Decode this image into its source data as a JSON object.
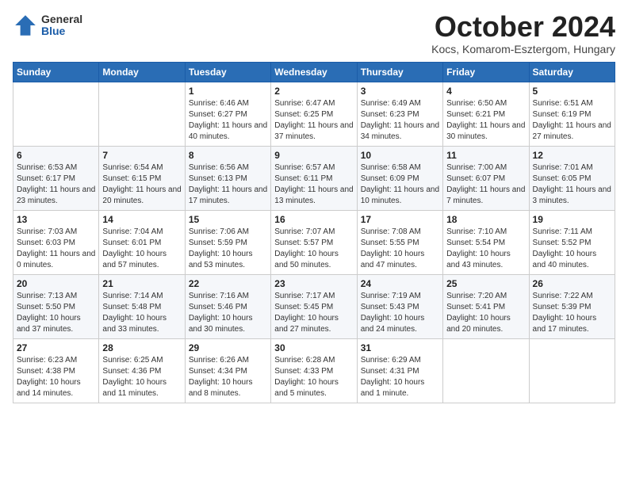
{
  "logo": {
    "general": "General",
    "blue": "Blue"
  },
  "title": "October 2024",
  "subtitle": "Kocs, Komarom-Esztergom, Hungary",
  "headers": [
    "Sunday",
    "Monday",
    "Tuesday",
    "Wednesday",
    "Thursday",
    "Friday",
    "Saturday"
  ],
  "weeks": [
    [
      {
        "day": "",
        "detail": ""
      },
      {
        "day": "",
        "detail": ""
      },
      {
        "day": "1",
        "detail": "Sunrise: 6:46 AM\nSunset: 6:27 PM\nDaylight: 11 hours and 40 minutes."
      },
      {
        "day": "2",
        "detail": "Sunrise: 6:47 AM\nSunset: 6:25 PM\nDaylight: 11 hours and 37 minutes."
      },
      {
        "day": "3",
        "detail": "Sunrise: 6:49 AM\nSunset: 6:23 PM\nDaylight: 11 hours and 34 minutes."
      },
      {
        "day": "4",
        "detail": "Sunrise: 6:50 AM\nSunset: 6:21 PM\nDaylight: 11 hours and 30 minutes."
      },
      {
        "day": "5",
        "detail": "Sunrise: 6:51 AM\nSunset: 6:19 PM\nDaylight: 11 hours and 27 minutes."
      }
    ],
    [
      {
        "day": "6",
        "detail": "Sunrise: 6:53 AM\nSunset: 6:17 PM\nDaylight: 11 hours and 23 minutes."
      },
      {
        "day": "7",
        "detail": "Sunrise: 6:54 AM\nSunset: 6:15 PM\nDaylight: 11 hours and 20 minutes."
      },
      {
        "day": "8",
        "detail": "Sunrise: 6:56 AM\nSunset: 6:13 PM\nDaylight: 11 hours and 17 minutes."
      },
      {
        "day": "9",
        "detail": "Sunrise: 6:57 AM\nSunset: 6:11 PM\nDaylight: 11 hours and 13 minutes."
      },
      {
        "day": "10",
        "detail": "Sunrise: 6:58 AM\nSunset: 6:09 PM\nDaylight: 11 hours and 10 minutes."
      },
      {
        "day": "11",
        "detail": "Sunrise: 7:00 AM\nSunset: 6:07 PM\nDaylight: 11 hours and 7 minutes."
      },
      {
        "day": "12",
        "detail": "Sunrise: 7:01 AM\nSunset: 6:05 PM\nDaylight: 11 hours and 3 minutes."
      }
    ],
    [
      {
        "day": "13",
        "detail": "Sunrise: 7:03 AM\nSunset: 6:03 PM\nDaylight: 11 hours and 0 minutes."
      },
      {
        "day": "14",
        "detail": "Sunrise: 7:04 AM\nSunset: 6:01 PM\nDaylight: 10 hours and 57 minutes."
      },
      {
        "day": "15",
        "detail": "Sunrise: 7:06 AM\nSunset: 5:59 PM\nDaylight: 10 hours and 53 minutes."
      },
      {
        "day": "16",
        "detail": "Sunrise: 7:07 AM\nSunset: 5:57 PM\nDaylight: 10 hours and 50 minutes."
      },
      {
        "day": "17",
        "detail": "Sunrise: 7:08 AM\nSunset: 5:55 PM\nDaylight: 10 hours and 47 minutes."
      },
      {
        "day": "18",
        "detail": "Sunrise: 7:10 AM\nSunset: 5:54 PM\nDaylight: 10 hours and 43 minutes."
      },
      {
        "day": "19",
        "detail": "Sunrise: 7:11 AM\nSunset: 5:52 PM\nDaylight: 10 hours and 40 minutes."
      }
    ],
    [
      {
        "day": "20",
        "detail": "Sunrise: 7:13 AM\nSunset: 5:50 PM\nDaylight: 10 hours and 37 minutes."
      },
      {
        "day": "21",
        "detail": "Sunrise: 7:14 AM\nSunset: 5:48 PM\nDaylight: 10 hours and 33 minutes."
      },
      {
        "day": "22",
        "detail": "Sunrise: 7:16 AM\nSunset: 5:46 PM\nDaylight: 10 hours and 30 minutes."
      },
      {
        "day": "23",
        "detail": "Sunrise: 7:17 AM\nSunset: 5:45 PM\nDaylight: 10 hours and 27 minutes."
      },
      {
        "day": "24",
        "detail": "Sunrise: 7:19 AM\nSunset: 5:43 PM\nDaylight: 10 hours and 24 minutes."
      },
      {
        "day": "25",
        "detail": "Sunrise: 7:20 AM\nSunset: 5:41 PM\nDaylight: 10 hours and 20 minutes."
      },
      {
        "day": "26",
        "detail": "Sunrise: 7:22 AM\nSunset: 5:39 PM\nDaylight: 10 hours and 17 minutes."
      }
    ],
    [
      {
        "day": "27",
        "detail": "Sunrise: 6:23 AM\nSunset: 4:38 PM\nDaylight: 10 hours and 14 minutes."
      },
      {
        "day": "28",
        "detail": "Sunrise: 6:25 AM\nSunset: 4:36 PM\nDaylight: 10 hours and 11 minutes."
      },
      {
        "day": "29",
        "detail": "Sunrise: 6:26 AM\nSunset: 4:34 PM\nDaylight: 10 hours and 8 minutes."
      },
      {
        "day": "30",
        "detail": "Sunrise: 6:28 AM\nSunset: 4:33 PM\nDaylight: 10 hours and 5 minutes."
      },
      {
        "day": "31",
        "detail": "Sunrise: 6:29 AM\nSunset: 4:31 PM\nDaylight: 10 hours and 1 minute."
      },
      {
        "day": "",
        "detail": ""
      },
      {
        "day": "",
        "detail": ""
      }
    ]
  ]
}
